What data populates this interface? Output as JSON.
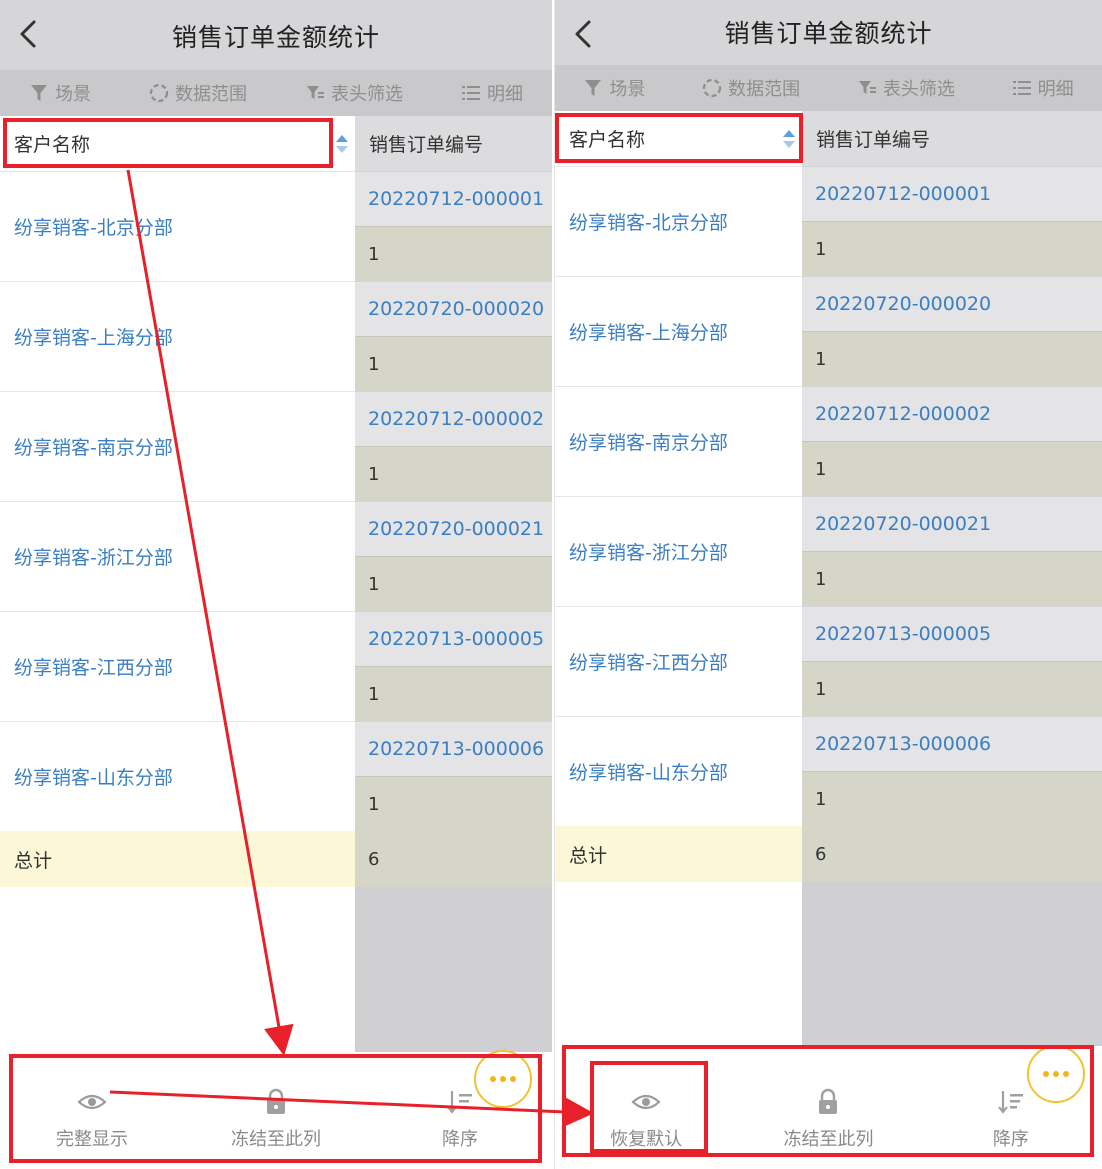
{
  "colors": {
    "link": "#3a7fc2",
    "annotation": "#e8202a",
    "more_ring": "#f2c233"
  },
  "title": "销售订单金额统计",
  "toolbar": {
    "scene": "场景",
    "data_range": "数据范围",
    "header_filter": "表头筛选",
    "detail": "明细"
  },
  "columns": {
    "customer": "客户名称",
    "order_no": "销售订单编号"
  },
  "rows": [
    {
      "customer": "纷享销客-北京分部",
      "order_no": "20220712-000001",
      "amount": "1"
    },
    {
      "customer": "纷享销客-上海分部",
      "order_no": "20220720-000020",
      "amount": "1"
    },
    {
      "customer": "纷享销客-南京分部",
      "order_no": "20220712-000002",
      "amount": "1"
    },
    {
      "customer": "纷享销客-浙江分部",
      "order_no": "20220720-000021",
      "amount": "1"
    },
    {
      "customer": "纷享销客-江西分部",
      "order_no": "20220713-000005",
      "amount": "1"
    },
    {
      "customer": "纷享销客-山东分部",
      "order_no": "20220713-000006",
      "amount": "1"
    }
  ],
  "total": {
    "label": "总计",
    "value": "6"
  },
  "left_bar": {
    "show_full": "完整显示",
    "freeze": "冻结至此列",
    "sort_desc": "降序"
  },
  "right_bar": {
    "restore_default": "恢复默认",
    "freeze": "冻结至此列",
    "sort_desc": "降序"
  },
  "icons": [
    "chevron-left-icon",
    "funnel-icon",
    "scope-ring-icon",
    "column-filter-icon",
    "list-icon",
    "sort-arrows-icon",
    "eye-icon",
    "lock-icon",
    "sort-descending-icon",
    "more-dots-icon"
  ]
}
